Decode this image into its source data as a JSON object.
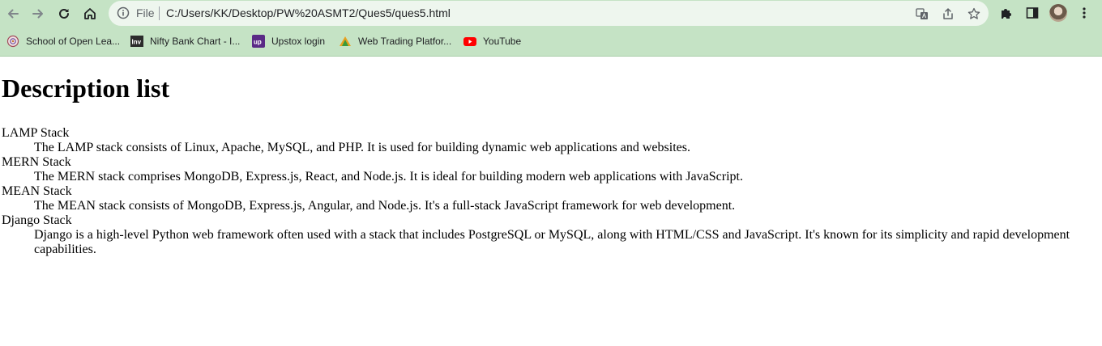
{
  "browser": {
    "scheme_label": "File",
    "url": "C:/Users/KK/Desktop/PW%20ASMT2/Ques5/ques5.html",
    "bookmarks": [
      {
        "label": "School of Open Lea...",
        "icon": "school-logo-icon"
      },
      {
        "label": "Nifty Bank Chart - I...",
        "icon": "investing-logo-icon"
      },
      {
        "label": "Upstox login",
        "icon": "upstox-logo-icon"
      },
      {
        "label": "Web Trading Platfor...",
        "icon": "trading-logo-icon"
      },
      {
        "label": "YouTube",
        "icon": "youtube-logo-icon"
      }
    ],
    "colors": {
      "chrome_bg": "#c5e3c5",
      "omnibox_bg": "#eef6ee"
    }
  },
  "page": {
    "heading": "Description list",
    "items": [
      {
        "term": "LAMP Stack",
        "description": "The LAMP stack consists of Linux, Apache, MySQL, and PHP. It is used for building dynamic web applications and websites."
      },
      {
        "term": "MERN Stack",
        "description": "The MERN stack comprises MongoDB, Express.js, React, and Node.js. It is ideal for building modern web applications with JavaScript."
      },
      {
        "term": "MEAN Stack",
        "description": "The MEAN stack consists of MongoDB, Express.js, Angular, and Node.js. It's a full-stack JavaScript framework for web development."
      },
      {
        "term": "Django Stack",
        "description": "Django is a high-level Python web framework often used with a stack that includes PostgreSQL or MySQL, along with HTML/CSS and JavaScript. It's known for its simplicity and rapid development capabilities."
      }
    ]
  }
}
